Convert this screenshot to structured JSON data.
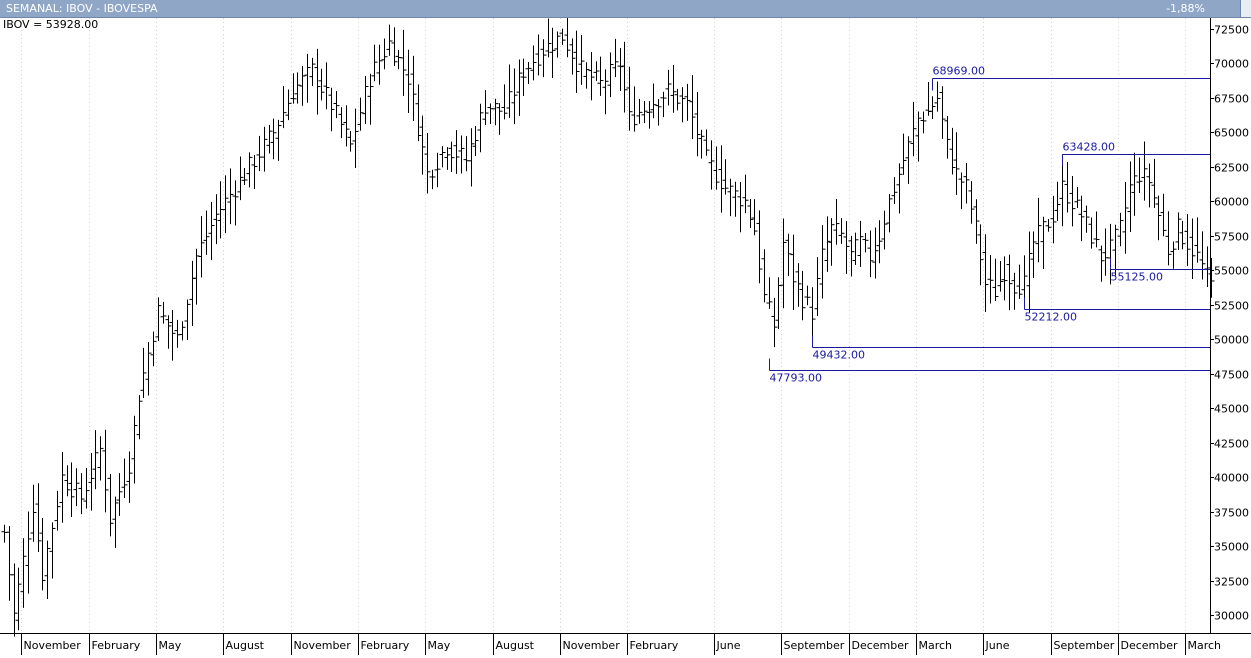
{
  "window": {
    "title": "SEMANAL: IBOV - IBOVESPA",
    "change": "-1,88%"
  },
  "readout": "IBOV = 53928.00",
  "chart_data": {
    "type": "ohlc",
    "title": "SEMANAL: IBOV - IBOVESPA",
    "y_ticks": [
      30000,
      32500,
      35000,
      37500,
      40000,
      42500,
      45000,
      47500,
      50000,
      52500,
      55000,
      57500,
      60000,
      62500,
      65000,
      67500,
      70000,
      72500
    ],
    "y_range": [
      29500,
      73500
    ],
    "x_labels": [
      "November",
      "February",
      "May",
      "August",
      "November",
      "February",
      "May",
      "August",
      "November",
      "February",
      "June",
      "September",
      "December",
      "March",
      "June",
      "September",
      "December",
      "March"
    ],
    "x_label_bar_index": [
      4,
      18,
      32,
      46,
      60,
      74,
      88,
      102,
      116,
      130,
      148,
      162,
      176,
      190,
      204,
      218,
      232,
      246
    ],
    "levels": [
      {
        "label": "68969.00",
        "value": 68969,
        "from_bar": 193
      },
      {
        "label": "63428.00",
        "value": 63428,
        "from_bar": 220
      },
      {
        "label": "55125.00",
        "value": 55125,
        "from_bar": 230
      },
      {
        "label": "52212.00",
        "value": 52212,
        "from_bar": 212
      },
      {
        "label": "49432.00",
        "value": 49432,
        "from_bar": 168
      },
      {
        "label": "47793.00",
        "value": 47793,
        "from_bar": 159
      }
    ],
    "anchors": [
      [
        0,
        36000
      ],
      [
        2,
        30000
      ],
      [
        6,
        38000
      ],
      [
        8,
        33000
      ],
      [
        12,
        40000
      ],
      [
        16,
        38500
      ],
      [
        20,
        42000
      ],
      [
        22,
        37000
      ],
      [
        26,
        41000
      ],
      [
        28,
        46000
      ],
      [
        32,
        52000
      ],
      [
        36,
        50000
      ],
      [
        40,
        56000
      ],
      [
        44,
        59000
      ],
      [
        48,
        61000
      ],
      [
        52,
        63000
      ],
      [
        56,
        65000
      ],
      [
        60,
        68000
      ],
      [
        64,
        69500
      ],
      [
        68,
        67000
      ],
      [
        72,
        64000
      ],
      [
        76,
        69000
      ],
      [
        80,
        71500
      ],
      [
        84,
        69000
      ],
      [
        88,
        62000
      ],
      [
        92,
        64000
      ],
      [
        96,
        63000
      ],
      [
        100,
        67000
      ],
      [
        104,
        66500
      ],
      [
        108,
        69500
      ],
      [
        112,
        71000
      ],
      [
        116,
        72000
      ],
      [
        120,
        69500
      ],
      [
        124,
        68500
      ],
      [
        128,
        70000
      ],
      [
        130,
        66000
      ],
      [
        134,
        67000
      ],
      [
        138,
        68000
      ],
      [
        142,
        67000
      ],
      [
        146,
        63000
      ],
      [
        150,
        61000
      ],
      [
        154,
        60000
      ],
      [
        156,
        58000
      ],
      [
        158,
        53000
      ],
      [
        160,
        51000
      ],
      [
        162,
        57000
      ],
      [
        164,
        54500
      ],
      [
        166,
        53000
      ],
      [
        168,
        52000
      ],
      [
        170,
        56000
      ],
      [
        172,
        58000
      ],
      [
        174,
        57500
      ],
      [
        176,
        56000
      ],
      [
        178,
        57000
      ],
      [
        180,
        56000
      ],
      [
        182,
        57500
      ],
      [
        184,
        60000
      ],
      [
        188,
        64000
      ],
      [
        190,
        66000
      ],
      [
        192,
        66500
      ],
      [
        194,
        67500
      ],
      [
        196,
        64000
      ],
      [
        198,
        62000
      ],
      [
        200,
        61000
      ],
      [
        202,
        58000
      ],
      [
        204,
        54000
      ],
      [
        206,
        53500
      ],
      [
        208,
        55000
      ],
      [
        210,
        54000
      ],
      [
        212,
        54000
      ],
      [
        214,
        57000
      ],
      [
        216,
        58000
      ],
      [
        218,
        59000
      ],
      [
        220,
        61000
      ],
      [
        222,
        60000
      ],
      [
        224,
        59000
      ],
      [
        226,
        57500
      ],
      [
        228,
        56000
      ],
      [
        230,
        56500
      ],
      [
        232,
        58000
      ],
      [
        234,
        61000
      ],
      [
        236,
        62000
      ],
      [
        238,
        61500
      ],
      [
        240,
        59000
      ],
      [
        242,
        56500
      ],
      [
        244,
        58000
      ],
      [
        246,
        57000
      ],
      [
        248,
        56000
      ],
      [
        250,
        54500
      ],
      [
        251,
        53928
      ]
    ],
    "grid": false
  }
}
